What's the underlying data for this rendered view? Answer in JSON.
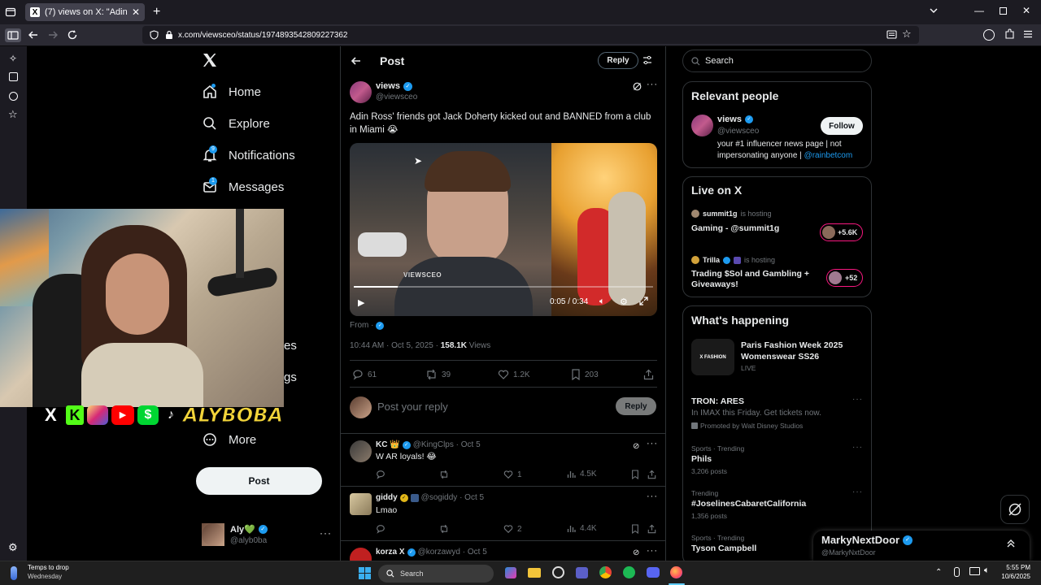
{
  "browser": {
    "tab_title": "(7) views on X: \"Adin Ross' frien",
    "url": "x.com/viewsceo/status/1974893542809227362"
  },
  "nav": {
    "home": "Home",
    "explore": "Explore",
    "notifications": "Notifications",
    "notifications_badge": "9",
    "messages": "Messages",
    "messages_badge": "1",
    "partial_1": "es",
    "partial_2": "gs",
    "more": "More",
    "post_button": "Post"
  },
  "account": {
    "name": "Aly💚",
    "handle": "@alyb0ba"
  },
  "overlay": {
    "brand_text": "ALYBOBA"
  },
  "post": {
    "header_title": "Post",
    "reply_button": "Reply",
    "author_name": "views",
    "author_handle": "@viewsceo",
    "text": "Adin Ross' friends got Jack Doherty kicked out and BANNED from a club in Miami 😭",
    "video_watermark": "VIEWSCEO",
    "video_time": "0:05 / 0:34",
    "video_progress": 0.147,
    "from_label": "From ·",
    "time": "10:44 AM · Oct 5, 2025 · ",
    "views_count": "158.1K",
    "views_label": " Views",
    "stats": {
      "replies": "61",
      "reposts": "39",
      "likes": "1.2K",
      "bookmarks": "203"
    },
    "reply_placeholder": "Post your reply",
    "reply_submit": "Reply"
  },
  "replies": [
    {
      "name": "KC 👑",
      "handle": "@KingClps · Oct 5",
      "text": "W AR loyals! 😂",
      "replies": "",
      "reposts": "",
      "likes": "1",
      "views": "4.5K"
    },
    {
      "name": "giddy",
      "handle": "@sogiddy · Oct 5",
      "text": "Lmao",
      "replies": "",
      "reposts": "",
      "likes": "2",
      "views": "4.4K"
    },
    {
      "name": "korza X",
      "handle": "@korzawyd · Oct 5",
      "text": "",
      "replies": "",
      "reposts": "",
      "likes": "",
      "views": ""
    }
  ],
  "right": {
    "search_placeholder": "Search",
    "relevant": {
      "title": "Relevant people",
      "name": "views",
      "handle": "@viewsceo",
      "follow": "Follow",
      "bio": "your #1 influencer news page | not impersonating anyone | ",
      "bio_link": "@rainbetcom"
    },
    "live": {
      "title": "Live on X",
      "items": [
        {
          "host": "summit1g",
          "hosting": "is hosting",
          "title": "Gaming - @summit1g",
          "count": "+5.6K"
        },
        {
          "host": "Trilla",
          "hosting": "is hosting",
          "title": "Trading $Sol and Gambling + Giveaways!",
          "count": "+52"
        }
      ]
    },
    "happening": {
      "title": "What's happening",
      "event": {
        "title": "Paris Fashion Week 2025 Womenswear SS26",
        "status": "LIVE",
        "thumb_text": "X FASHION"
      },
      "promo": {
        "title": "TRON: ARES",
        "sub": "In IMAX this Friday. Get tickets now.",
        "promoted": "Promoted by Walt Disney Studios"
      },
      "trends": [
        {
          "meta": "Sports · Trending",
          "name": "Phils",
          "count": "3,206 posts"
        },
        {
          "meta": "Trending",
          "name": "#JoselinesCabaretCalifornia",
          "count": "1,356 posts"
        },
        {
          "meta": "Sports · Trending",
          "name": "Tyson Campbell",
          "count": ""
        }
      ]
    }
  },
  "messages_drawer": {
    "name": "MarkyNextDoor",
    "handle": "@MarkyNxtDoor"
  },
  "taskbar": {
    "weather_title": "Temps to drop",
    "weather_sub": "Wednesday",
    "search": "Search",
    "time": "5:55 PM",
    "date": "10/6/2025"
  }
}
